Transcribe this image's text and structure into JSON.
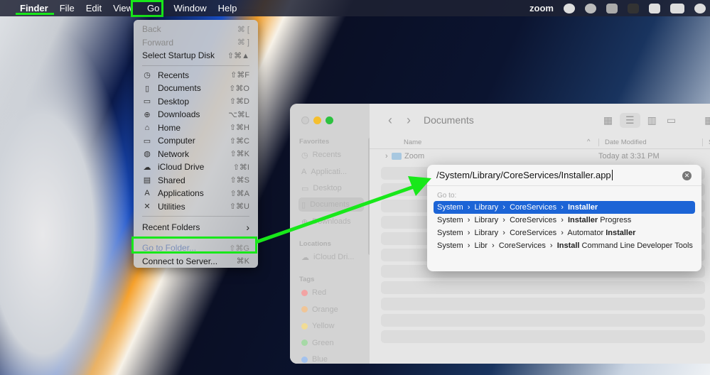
{
  "menubar": {
    "apple": "",
    "items": [
      "Finder",
      "File",
      "Edit",
      "View",
      "Go",
      "Window",
      "Help"
    ],
    "status": {
      "zoom": "zoom"
    }
  },
  "go_menu": {
    "top": [
      {
        "label": "Back",
        "shortcut": "⌘ [",
        "disabled": true
      },
      {
        "label": "Forward",
        "shortcut": "⌘ ]",
        "disabled": true
      },
      {
        "label": "Select Startup Disk",
        "shortcut": "⇧⌘▲"
      }
    ],
    "places": [
      {
        "icon": "clock-icon",
        "g": "◷",
        "label": "Recents",
        "shortcut": "⇧⌘F"
      },
      {
        "icon": "document-icon",
        "g": "▯",
        "label": "Documents",
        "shortcut": "⇧⌘O"
      },
      {
        "icon": "desktop-icon",
        "g": "▭",
        "label": "Desktop",
        "shortcut": "⇧⌘D"
      },
      {
        "icon": "download-icon",
        "g": "⊕",
        "label": "Downloads",
        "shortcut": "⌥⌘L"
      },
      {
        "icon": "home-icon",
        "g": "⌂",
        "label": "Home",
        "shortcut": "⇧⌘H"
      },
      {
        "icon": "computer-icon",
        "g": "▭",
        "label": "Computer",
        "shortcut": "⇧⌘C"
      },
      {
        "icon": "network-icon",
        "g": "◍",
        "label": "Network",
        "shortcut": "⇧⌘K"
      },
      {
        "icon": "cloud-icon",
        "g": "☁",
        "label": "iCloud Drive",
        "shortcut": "⇧⌘I"
      },
      {
        "icon": "shared-folder-icon",
        "g": "▤",
        "label": "Shared",
        "shortcut": "⇧⌘S"
      },
      {
        "icon": "applications-icon",
        "g": "A",
        "label": "Applications",
        "shortcut": "⇧⌘A"
      },
      {
        "icon": "utilities-icon",
        "g": "✕",
        "label": "Utilities",
        "shortcut": "⇧⌘U"
      }
    ],
    "recent_folders": {
      "label": "Recent Folders",
      "chevron": "›"
    },
    "bottom": [
      {
        "label": "Go to Folder...",
        "shortcut": "⇧⌘G",
        "disabled": true
      },
      {
        "label": "Connect to Server...",
        "shortcut": "⌘K"
      }
    ]
  },
  "finder": {
    "title": "Documents",
    "sidebar": {
      "favorites": "Favorites",
      "fav_items": [
        "Recents",
        "Applicati...",
        "Desktop",
        "Documents",
        "Downloads"
      ],
      "locations": "Locations",
      "loc_items": [
        "iCloud Dri..."
      ],
      "tags": "Tags",
      "tag_items": [
        {
          "label": "Red",
          "color": "#f2a3a3"
        },
        {
          "label": "Orange",
          "color": "#f0c597"
        },
        {
          "label": "Yellow",
          "color": "#f1dc95"
        },
        {
          "label": "Green",
          "color": "#a6d9a6"
        },
        {
          "label": "Blue",
          "color": "#a3c2ee"
        }
      ]
    },
    "columns": {
      "name": "Name",
      "date": "Date Modified",
      "size": "S"
    },
    "rows": [
      {
        "name": "Zoom",
        "date": "Today at 3:31 PM"
      }
    ]
  },
  "goto_dialog": {
    "path": "/System/Library/CoreServices/Installer.app",
    "label": "Go to:",
    "suggestions": [
      {
        "pre": "System  ›  Library  ›  CoreServices  ›  ",
        "bold": "Installer",
        "post": ""
      },
      {
        "pre": "System  ›  Library  ›  CoreServices  ›  ",
        "bold": "Installer",
        "post": " Progress"
      },
      {
        "pre": "System  ›  Library  ›  CoreServices  ›  Automator ",
        "bold": "Installer",
        "post": ""
      },
      {
        "pre": "System  ›  Libr  ›  CoreServices  ›  ",
        "bold": "Install",
        "post": " Command Line Developer Tools"
      }
    ]
  },
  "colors": {
    "highlight": "#18e81a",
    "selection": "#1c64d6"
  }
}
